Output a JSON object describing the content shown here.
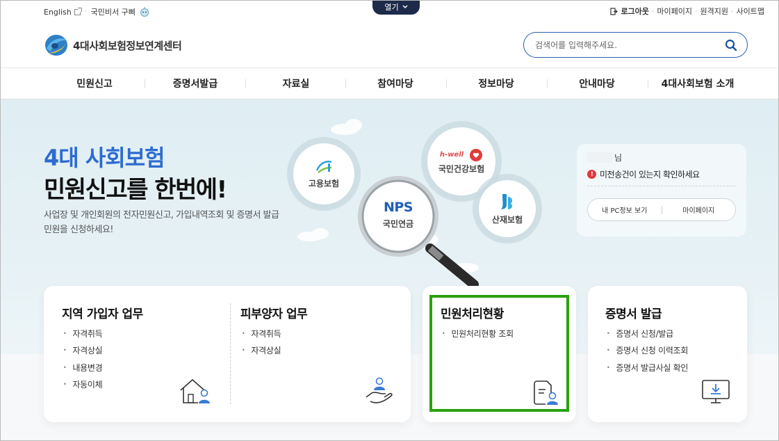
{
  "util": {
    "english": "English",
    "secretary": "국민비서 구삐",
    "open_label": "열기",
    "login": "로그아웃",
    "mypage": "마이페이지",
    "remote": "원격지원",
    "sitemap": "사이트맵"
  },
  "header": {
    "logo_text": "4대사회보험정보연계센터",
    "search_placeholder": "검색어를 입력해주세요."
  },
  "gnb": [
    "민원신고",
    "증명서발급",
    "자료실",
    "참여마당",
    "정보마당",
    "안내마당",
    "4대사회보험 소개"
  ],
  "hero": {
    "title_line1": "4대 사회보험",
    "title_line2": "민원신고를 한번에!",
    "desc": "사업장 및 개인회원의 전자민원신고, 가입내역조회 및 증명서 발급 민원을 신청하세요!",
    "circles": {
      "employment": "고용보험",
      "health_brand": "h-well",
      "health": "국민건강보험",
      "pension_brand": "NPS",
      "pension": "국민연금",
      "industrial": "산재보험"
    }
  },
  "user_panel": {
    "suffix": "님",
    "alert": "미전송건이 있는지 확인하세요",
    "btn_pc": "내 PC정보 보기",
    "btn_mypage": "마이페이지"
  },
  "cards": {
    "regional": {
      "title": "지역 가입자 업무",
      "items": [
        "자격취득",
        "자격상실",
        "내용변경",
        "자동이체"
      ]
    },
    "dependent": {
      "title": "피부양자 업무",
      "items": [
        "자격취득",
        "자격상실"
      ]
    },
    "status": {
      "title": "민원처리현황",
      "items": [
        "민원처리현황 조회"
      ]
    },
    "cert": {
      "title": "증명서 발급",
      "items": [
        "증명서 신청/발급",
        "증명서 신청 이력조회",
        "증명서 발급사실 확인"
      ]
    }
  },
  "colors": {
    "brand_blue": "#2d6bd0",
    "nav_dark": "#1d2a4a",
    "highlight_green": "#2aa10f",
    "alert_red": "#e0393e"
  }
}
